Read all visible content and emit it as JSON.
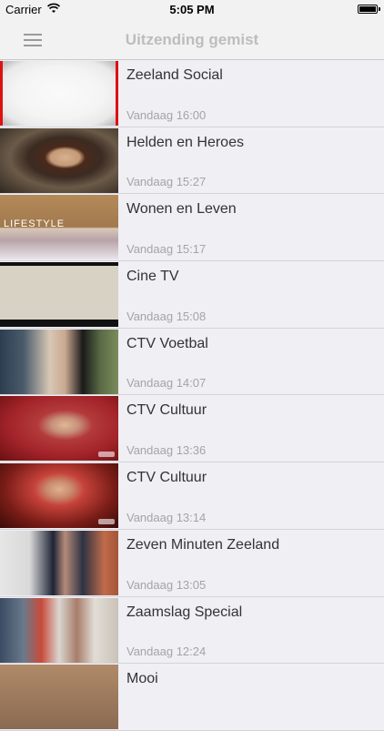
{
  "status_bar": {
    "carrier": "Carrier",
    "time": "5:05 PM"
  },
  "nav": {
    "title": "Uitzending gemist",
    "menu_icon": "hamburger-menu-icon"
  },
  "items": [
    {
      "title": "Zeeland Social",
      "time": "Vandaag 16:00"
    },
    {
      "title": "Helden en Heroes",
      "time": "Vandaag 15:27"
    },
    {
      "title": "Wonen en Leven",
      "time": "Vandaag 15:17",
      "thumb_label": "LIFESTYLE"
    },
    {
      "title": "Cine TV",
      "time": "Vandaag 15:08"
    },
    {
      "title": "CTV Voetbal",
      "time": "Vandaag 14:07"
    },
    {
      "title": "CTV Cultuur",
      "time": "Vandaag 13:36"
    },
    {
      "title": "CTV Cultuur",
      "time": "Vandaag 13:14"
    },
    {
      "title": "Zeven Minuten Zeeland",
      "time": "Vandaag 13:05"
    },
    {
      "title": "Zaamslag Special",
      "time": "Vandaag 12:24"
    },
    {
      "title": "Mooi",
      "time": ""
    }
  ],
  "colors": {
    "background": "#efeff4",
    "nav_title": "#bdbdbd",
    "timestamp": "#a5a5a5"
  }
}
